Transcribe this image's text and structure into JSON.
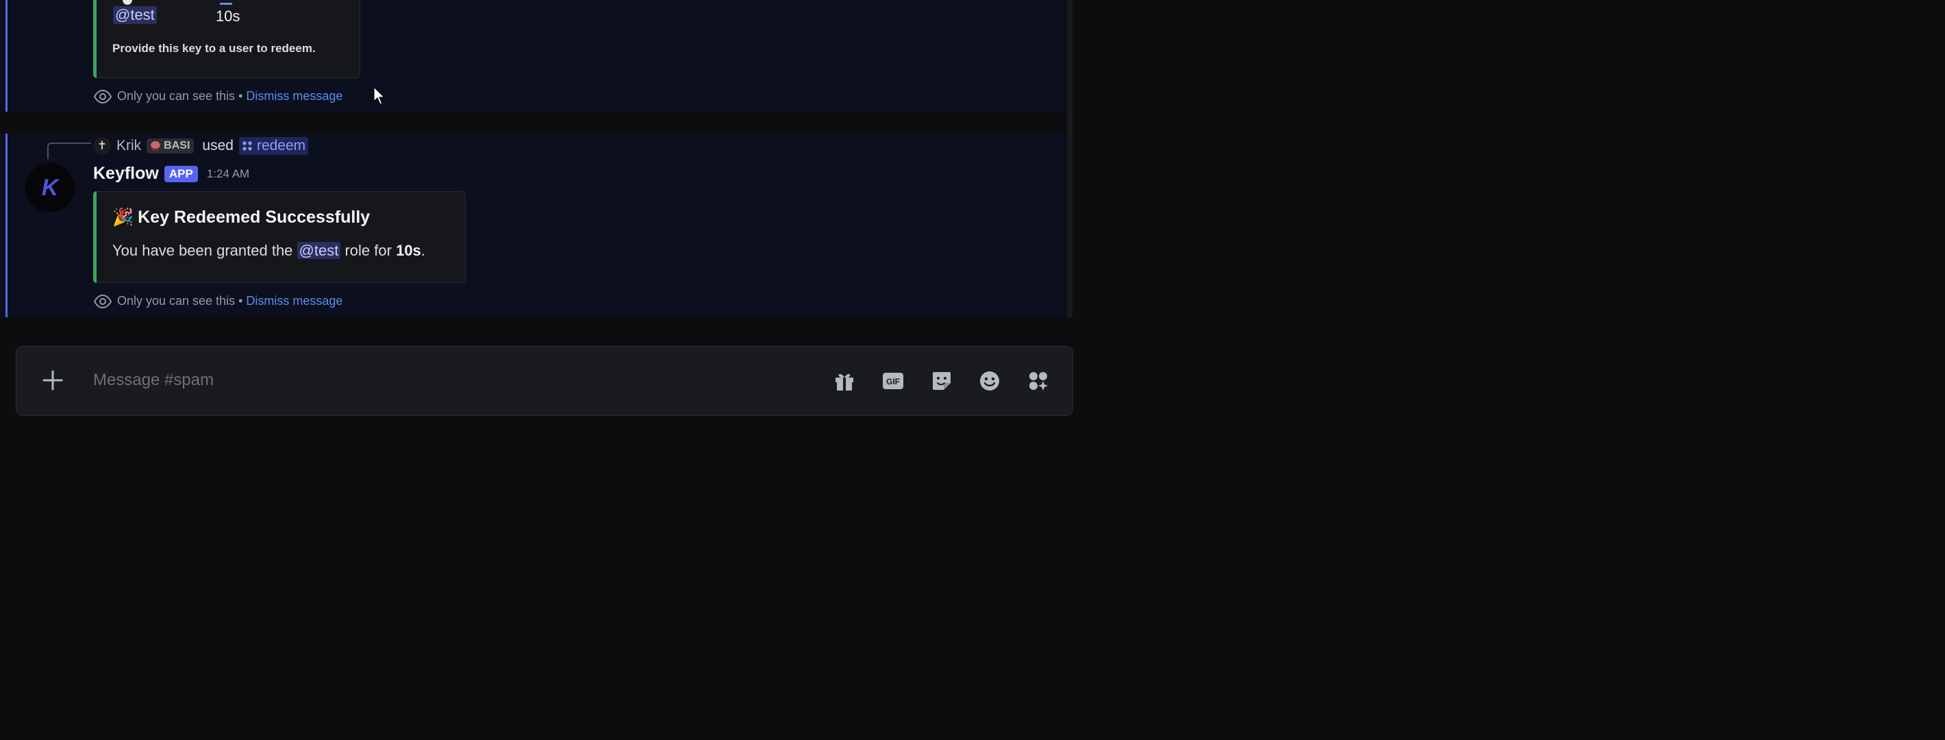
{
  "message1": {
    "role_mention": "@test",
    "duration": "10s",
    "embed_note": "Provide this key to a user to redeem.",
    "ephemeral_text": "Only you can see this",
    "separator": "•",
    "dismiss_label": "Dismiss message"
  },
  "message2": {
    "reply": {
      "user_name": "Krik",
      "user_avatar_glyph": "✝",
      "tag": "BASI",
      "used_text": "used",
      "command_name": "redeem"
    },
    "author": "Keyflow",
    "app_badge": "APP",
    "timestamp": "1:24 AM",
    "avatar_glyph": "K",
    "embed": {
      "emoji": "🎉",
      "title": "Key Redeemed Successfully",
      "desc_pre": "You have been granted the",
      "role_mention": "@test",
      "desc_mid": "role for",
      "duration": "10s",
      "desc_end": "."
    },
    "ephemeral_text": "Only you can see this",
    "separator": "•",
    "dismiss_label": "Dismiss message"
  },
  "composer": {
    "placeholder": "Message #spam",
    "icons": [
      "gift-icon",
      "gif-icon",
      "sticker-icon",
      "emoji-icon",
      "apps-icon"
    ]
  },
  "colors": {
    "accent": "#5865f2",
    "embed_bar": "#3ba55c",
    "link": "#5b8def",
    "message_bg": "#0b0f1e",
    "page_bg": "#0d0d10"
  }
}
